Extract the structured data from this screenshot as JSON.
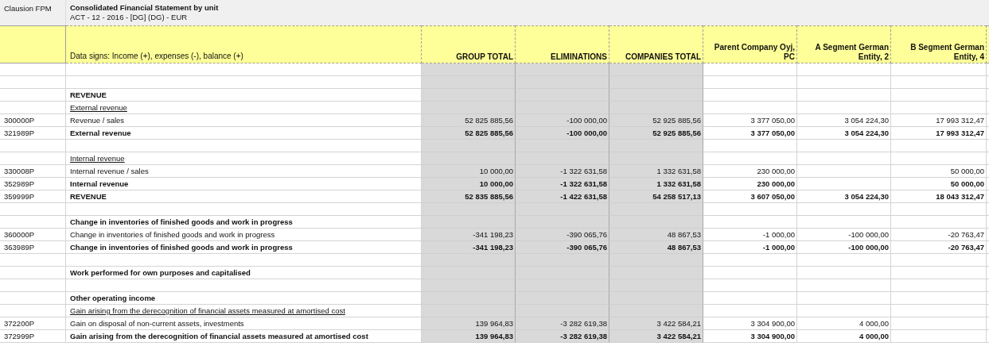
{
  "report": {
    "app": "Clausion FPM",
    "title": "Consolidated Financial  Statement by unit",
    "subtitle": "ACT - 12 - 2016 - [DG] (DG) - EUR"
  },
  "table": {
    "label_header": "Data signs: Income (+), expenses (-), balance (+)",
    "columns": [
      {
        "label": "GROUP TOTAL",
        "shaded": true
      },
      {
        "label": "ELIMINATIONS",
        "shaded": true
      },
      {
        "label": "COMPANIES TOTAL",
        "shaded": true
      },
      {
        "label": "Parent Company Oyj, PC",
        "shaded": false
      },
      {
        "label": "A Segment German Entity, 2",
        "shaded": false
      },
      {
        "label": "B Segment German Entity, 4",
        "shaded": false
      }
    ],
    "rows": [
      {
        "kind": "blank"
      },
      {
        "kind": "blank"
      },
      {
        "kind": "heading",
        "label": "REVENUE"
      },
      {
        "kind": "subheading",
        "label": "External revenue"
      },
      {
        "kind": "line",
        "code": "300000P",
        "label": "Revenue / sales",
        "cells": [
          {
            "text": "52 825 885,56"
          },
          {
            "text": "-100 000,00"
          },
          {
            "text": "52 925 885,56"
          },
          {
            "text": "3 377 050,00"
          },
          {
            "text": "3 054 224,30"
          },
          {
            "text": "17 993 312,47"
          }
        ]
      },
      {
        "kind": "total",
        "code": "321989P",
        "label": "External revenue",
        "cells": [
          {
            "text": "52 825 885,56"
          },
          {
            "text": "-100 000,00"
          },
          {
            "text": "52 925 885,56"
          },
          {
            "text": "3 377 050,00"
          },
          {
            "text": "3 054 224,30"
          },
          {
            "text": "17 993 312,47"
          }
        ]
      },
      {
        "kind": "blank"
      },
      {
        "kind": "subheading",
        "label": "Internal revenue"
      },
      {
        "kind": "line",
        "code": "330008P",
        "label": "Internal revenue / sales",
        "cells": [
          {
            "text": "10 000,00"
          },
          {
            "text": "-1 322 631,58"
          },
          {
            "text": "1 332 631,58"
          },
          {
            "text": "230 000,00"
          },
          {},
          {
            "text": "50 000,00"
          }
        ]
      },
      {
        "kind": "total",
        "code": "352989P",
        "label": "Internal revenue",
        "cells": [
          {
            "text": "10 000,00"
          },
          {
            "text": "-1 322 631,58"
          },
          {
            "text": "1 332 631,58"
          },
          {
            "text": "230 000,00"
          },
          {},
          {
            "text": "50 000,00"
          }
        ]
      },
      {
        "kind": "total",
        "code": "359999P",
        "label": "REVENUE",
        "cells": [
          {
            "text": "52 835 885,56"
          },
          {
            "text": "-1 422 631,58"
          },
          {
            "text": "54 258 517,13"
          },
          {
            "text": "3 607 050,00"
          },
          {
            "text": "3 054 224,30"
          },
          {
            "text": "18 043 312,47"
          }
        ]
      },
      {
        "kind": "blank"
      },
      {
        "kind": "heading",
        "label": "Change in inventories of finished goods and work in progress"
      },
      {
        "kind": "line",
        "code": "360000P",
        "label": "Change in inventories of finished goods and work in progress",
        "cells": [
          {
            "text": "-341 198,23"
          },
          {
            "text": "-390 065,76"
          },
          {
            "text": "48 867,53"
          },
          {
            "text": "-1 000,00"
          },
          {
            "text": "-100 000,00"
          },
          {
            "text": "-20 763,47"
          }
        ]
      },
      {
        "kind": "total",
        "code": "363989P",
        "label": "Change in inventories of finished goods and work in progress",
        "cells": [
          {
            "text": "-341 198,23"
          },
          {
            "text": "-390 065,76"
          },
          {
            "text": "48 867,53"
          },
          {
            "text": "-1 000,00"
          },
          {
            "text": "-100 000,00"
          },
          {
            "text": "-20 763,47"
          }
        ]
      },
      {
        "kind": "blank"
      },
      {
        "kind": "heading",
        "label": "Work performed for own purposes and capitalised"
      },
      {
        "kind": "blank"
      },
      {
        "kind": "heading",
        "label": "Other operating income"
      },
      {
        "kind": "subheading",
        "label": "Gain arising from the derecognition of financial assets measured at amortised cost"
      },
      {
        "kind": "line",
        "code": "372200P",
        "label": "Gain on disposal of non-current assets, investments",
        "cells": [
          {
            "text": "139 964,83"
          },
          {
            "text": "-3 282 619,38"
          },
          {
            "text": "3 422 584,21"
          },
          {
            "text": "3 304 900,00"
          },
          {
            "text": "4 000,00"
          },
          {}
        ]
      },
      {
        "kind": "total",
        "code": "372999P",
        "label": "Gain arising from the derecognition of financial assets measured at amortised cost",
        "cells": [
          {
            "text": "139 964,83"
          },
          {
            "text": "-3 282 619,38"
          },
          {
            "text": "3 422 584,21"
          },
          {
            "text": "3 304 900,00"
          },
          {
            "text": "4 000,00"
          },
          {}
        ]
      }
    ]
  }
}
